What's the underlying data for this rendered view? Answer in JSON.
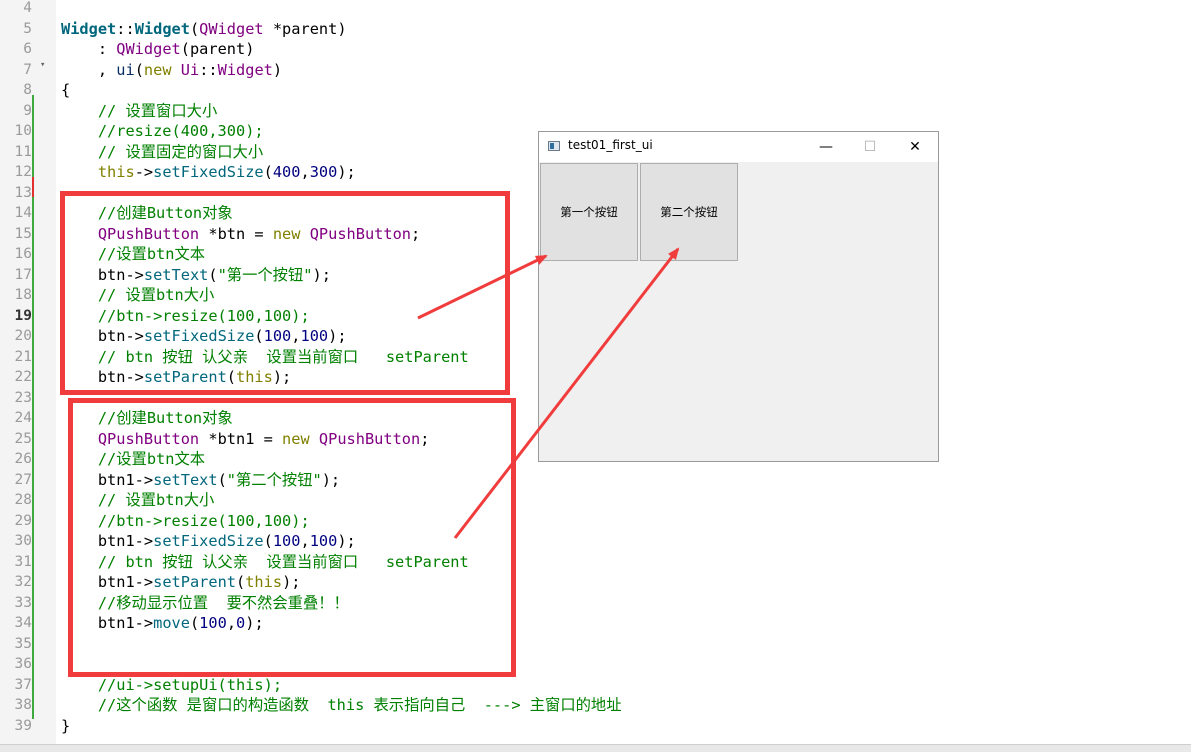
{
  "gutter": [
    {
      "num": "4"
    },
    {
      "num": "5"
    },
    {
      "num": "6"
    },
    {
      "num": "7"
    },
    {
      "num": "8"
    },
    {
      "num": "9"
    },
    {
      "num": "10"
    },
    {
      "num": "11"
    },
    {
      "num": "12"
    },
    {
      "num": "13"
    },
    {
      "num": "14"
    },
    {
      "num": "15"
    },
    {
      "num": "16"
    },
    {
      "num": "17"
    },
    {
      "num": "18"
    },
    {
      "num": "19"
    },
    {
      "num": "20"
    },
    {
      "num": "21"
    },
    {
      "num": "22"
    },
    {
      "num": "23"
    },
    {
      "num": "24"
    },
    {
      "num": "25"
    },
    {
      "num": "26"
    },
    {
      "num": "27"
    },
    {
      "num": "28"
    },
    {
      "num": "29"
    },
    {
      "num": "30"
    },
    {
      "num": "31"
    },
    {
      "num": "32"
    },
    {
      "num": "33"
    },
    {
      "num": "34"
    },
    {
      "num": "35"
    },
    {
      "num": "36"
    },
    {
      "num": "37"
    },
    {
      "num": "38"
    },
    {
      "num": "39"
    }
  ],
  "fold_marker": "▾",
  "code": [
    [],
    [
      [
        "fb",
        "Widget"
      ],
      [
        "p",
        "::"
      ],
      [
        "fb",
        "Widget"
      ],
      [
        "p",
        "("
      ],
      [
        "t",
        "QWidget"
      ],
      [
        "p",
        " *parent)"
      ]
    ],
    [
      [
        "p",
        "    : "
      ],
      [
        "t",
        "QWidget"
      ],
      [
        "p",
        "(parent)"
      ]
    ],
    [
      [
        "p",
        "    , "
      ],
      [
        "v",
        "ui"
      ],
      [
        "p",
        "("
      ],
      [
        "k",
        "new"
      ],
      [
        "p",
        " "
      ],
      [
        "t",
        "Ui"
      ],
      [
        "p",
        "::"
      ],
      [
        "t",
        "Widget"
      ],
      [
        "p",
        ")"
      ]
    ],
    [
      [
        "p",
        "{"
      ]
    ],
    [
      [
        "c",
        "    // 设置窗口大小"
      ]
    ],
    [
      [
        "c",
        "    //resize(400,300);"
      ]
    ],
    [
      [
        "c",
        "    // 设置固定的窗口大小"
      ]
    ],
    [
      [
        "k",
        "    this"
      ],
      [
        "p",
        "->"
      ],
      [
        "f",
        "setFixedSize"
      ],
      [
        "p",
        "("
      ],
      [
        "n",
        "400"
      ],
      [
        "p",
        ","
      ],
      [
        "n",
        "300"
      ],
      [
        "p",
        ");"
      ]
    ],
    [],
    [
      [
        "c",
        "    //创建Button对象"
      ]
    ],
    [
      [
        "t",
        "    QPushButton"
      ],
      [
        "p",
        " *btn = "
      ],
      [
        "k",
        "new"
      ],
      [
        "p",
        " "
      ],
      [
        "t",
        "QPushButton"
      ],
      [
        "p",
        ";"
      ]
    ],
    [
      [
        "c",
        "    //设置btn文本"
      ]
    ],
    [
      [
        "p",
        "    btn->"
      ],
      [
        "f",
        "setText"
      ],
      [
        "p",
        "("
      ],
      [
        "s",
        "\"第一个按钮\""
      ],
      [
        "p",
        ");"
      ]
    ],
    [
      [
        "c",
        "    // 设置btn大小"
      ]
    ],
    [
      [
        "c",
        "    //btn->resize(100,100);"
      ]
    ],
    [
      [
        "p",
        "    btn->"
      ],
      [
        "f",
        "setFixedSize"
      ],
      [
        "p",
        "("
      ],
      [
        "n",
        "100"
      ],
      [
        "p",
        ","
      ],
      [
        "n",
        "100"
      ],
      [
        "p",
        ");"
      ]
    ],
    [
      [
        "c",
        "    // btn 按钮 认父亲  设置当前窗口   setParent"
      ]
    ],
    [
      [
        "p",
        "    btn->"
      ],
      [
        "f",
        "setParent"
      ],
      [
        "p",
        "("
      ],
      [
        "k",
        "this"
      ],
      [
        "p",
        ");"
      ]
    ],
    [],
    [
      [
        "c",
        "    //创建Button对象"
      ]
    ],
    [
      [
        "t",
        "    QPushButton"
      ],
      [
        "p",
        " *btn1 = "
      ],
      [
        "k",
        "new"
      ],
      [
        "p",
        " "
      ],
      [
        "t",
        "QPushButton"
      ],
      [
        "p",
        ";"
      ]
    ],
    [
      [
        "c",
        "    //设置btn文本"
      ]
    ],
    [
      [
        "p",
        "    btn1->"
      ],
      [
        "f",
        "setText"
      ],
      [
        "p",
        "("
      ],
      [
        "s",
        "\"第二个按钮\""
      ],
      [
        "p",
        ");"
      ]
    ],
    [
      [
        "c",
        "    // 设置btn大小"
      ]
    ],
    [
      [
        "c",
        "    //btn->resize(100,100);"
      ]
    ],
    [
      [
        "p",
        "    btn1->"
      ],
      [
        "f",
        "setFixedSize"
      ],
      [
        "p",
        "("
      ],
      [
        "n",
        "100"
      ],
      [
        "p",
        ","
      ],
      [
        "n",
        "100"
      ],
      [
        "p",
        ");"
      ]
    ],
    [
      [
        "c",
        "    // btn 按钮 认父亲  设置当前窗口   setParent"
      ]
    ],
    [
      [
        "p",
        "    btn1->"
      ],
      [
        "f",
        "setParent"
      ],
      [
        "p",
        "("
      ],
      [
        "k",
        "this"
      ],
      [
        "p",
        ");"
      ]
    ],
    [
      [
        "c",
        "    //移动显示位置  要不然会重叠！！"
      ]
    ],
    [
      [
        "p",
        "    btn1->"
      ],
      [
        "f",
        "move"
      ],
      [
        "p",
        "("
      ],
      [
        "n",
        "100"
      ],
      [
        "p",
        ","
      ],
      [
        "n",
        "0"
      ],
      [
        "p",
        ");"
      ]
    ],
    [],
    [],
    [
      [
        "c",
        "    //ui->setupUi(this);"
      ]
    ],
    [
      [
        "c",
        "    //这个函数 是窗口的构造函数  this 表示指向自己  ---> 主窗口的地址"
      ]
    ],
    [
      [
        "p",
        "}"
      ]
    ]
  ],
  "qt_window": {
    "title": "test01_first_ui",
    "icon": "qt-app-icon",
    "minimize": "—",
    "maximize": "☐",
    "close": "✕",
    "button1": "第一个按钮",
    "button2": "第二个按钮"
  },
  "colors": {
    "annotation": "#f03c3c",
    "keyword": "#808000",
    "type": "#800080",
    "function": "#00677c",
    "comment": "#008000",
    "number": "#000080"
  }
}
